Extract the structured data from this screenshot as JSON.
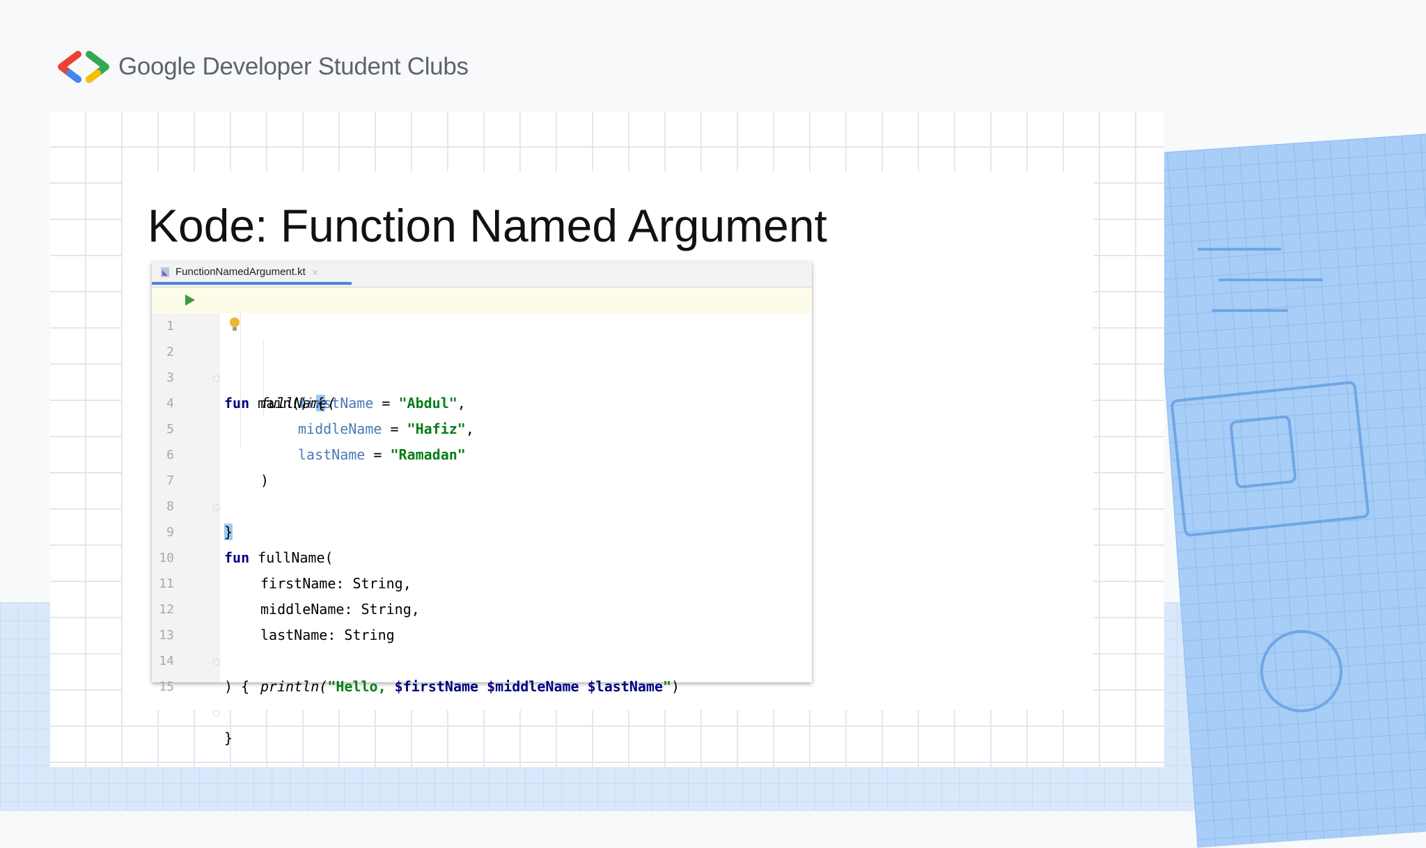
{
  "header": {
    "brand": "Google Developer Student Clubs",
    "logo_colors": [
      "#EA4335",
      "#4285F4",
      "#34A853",
      "#FBBC04"
    ]
  },
  "slide": {
    "title": "Kode: Function Named Argument"
  },
  "editor": {
    "tab_label": "FunctionNamedArgument.kt",
    "accent": "#4A84D9",
    "lines": [
      {
        "n": "1"
      },
      {
        "n": "2"
      },
      {
        "n": "3"
      },
      {
        "n": "4"
      },
      {
        "n": "5"
      },
      {
        "n": "6"
      },
      {
        "n": "7"
      },
      {
        "n": "8"
      },
      {
        "n": "9"
      },
      {
        "n": "10"
      },
      {
        "n": "11"
      },
      {
        "n": "12"
      },
      {
        "n": "13"
      },
      {
        "n": "14"
      },
      {
        "n": "15"
      }
    ],
    "code": {
      "l1_kw": "fun",
      "l1_rest": " main() ",
      "l1_brace": "{",
      "l2": "fullName(",
      "l3_param": "firstName",
      "l3_eq": " = ",
      "l3_str": "\"Abdul\"",
      "l3_end": ",",
      "l4_param": "middleName",
      "l4_eq": " = ",
      "l4_str": "\"Hafiz\"",
      "l4_end": ",",
      "l5_param": "lastName",
      "l5_eq": " = ",
      "l5_str": "\"Ramadan\"",
      "l6": ")",
      "l7": "}",
      "l9_kw": "fun",
      "l9_rest": " fullName(",
      "l10": "firstName: String,",
      "l11": "middleName: String,",
      "l12": "lastName: String",
      "l13": ") {",
      "l14_fn": "println(",
      "l14_str": "\"Hello, ",
      "l14_v1": "$firstName",
      "l14_sp1": " ",
      "l14_v2": "$middleName",
      "l14_sp2": " ",
      "l14_v3": "$lastName",
      "l14_end_str": "\"",
      "l14_close": ")",
      "l15": "}"
    },
    "icons": [
      "run-icon",
      "intention-bulb-icon",
      "kotlin-file-icon",
      "close-icon"
    ]
  }
}
